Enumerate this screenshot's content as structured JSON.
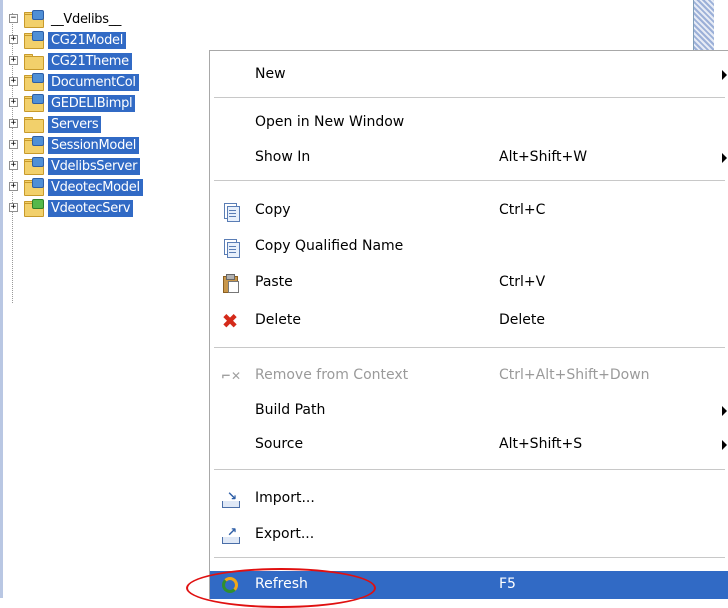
{
  "tree": {
    "items": [
      {
        "label": "__Vdelibs__",
        "expander": "−",
        "selected": false,
        "badge": "blue"
      },
      {
        "label": "CG21Model",
        "expander": "+",
        "selected": true,
        "badge": "blue"
      },
      {
        "label": "CG21Theme",
        "expander": "+",
        "selected": true,
        "badge": "none"
      },
      {
        "label": "DocumentCol",
        "expander": "+",
        "selected": true,
        "badge": "blue"
      },
      {
        "label": "GEDELIBimpl",
        "expander": "+",
        "selected": true,
        "badge": "blue"
      },
      {
        "label": "Servers",
        "expander": "+",
        "selected": true,
        "badge": "none"
      },
      {
        "label": "SessionModel",
        "expander": "+",
        "selected": true,
        "badge": "blue"
      },
      {
        "label": "VdelibsServer",
        "expander": "+",
        "selected": true,
        "badge": "blue"
      },
      {
        "label": "VdeotecModel",
        "expander": "+",
        "selected": true,
        "badge": "blue"
      },
      {
        "label": "VdeotecServ",
        "expander": "+",
        "selected": true,
        "badge": "green"
      }
    ]
  },
  "menu": {
    "new": {
      "label": "New"
    },
    "open_new_window": {
      "label": "Open in New Window"
    },
    "show_in": {
      "label": "Show In",
      "shortcut": "Alt+Shift+W"
    },
    "copy": {
      "label": "Copy",
      "shortcut": "Ctrl+C"
    },
    "copy_qualified": {
      "label": "Copy Qualified Name"
    },
    "paste": {
      "label": "Paste",
      "shortcut": "Ctrl+V"
    },
    "delete": {
      "label": "Delete",
      "shortcut": "Delete"
    },
    "remove_context": {
      "label": "Remove from Context",
      "shortcut": "Ctrl+Alt+Shift+Down"
    },
    "build_path": {
      "label": "Build Path"
    },
    "source": {
      "label": "Source",
      "shortcut": "Alt+Shift+S"
    },
    "import": {
      "label": "Import..."
    },
    "export": {
      "label": "Export..."
    },
    "refresh": {
      "label": "Refresh",
      "shortcut": "F5"
    }
  },
  "icons": {
    "copy": "copy-icon",
    "copy_qualified": "copy-qualified-name-icon",
    "paste": "paste-icon",
    "delete": "delete-icon",
    "remove_context": "remove-context-icon",
    "import": "import-icon",
    "export": "export-icon",
    "refresh": "refresh-icon"
  },
  "colors": {
    "selection": "#316ac5",
    "annotation": "#e01010"
  }
}
